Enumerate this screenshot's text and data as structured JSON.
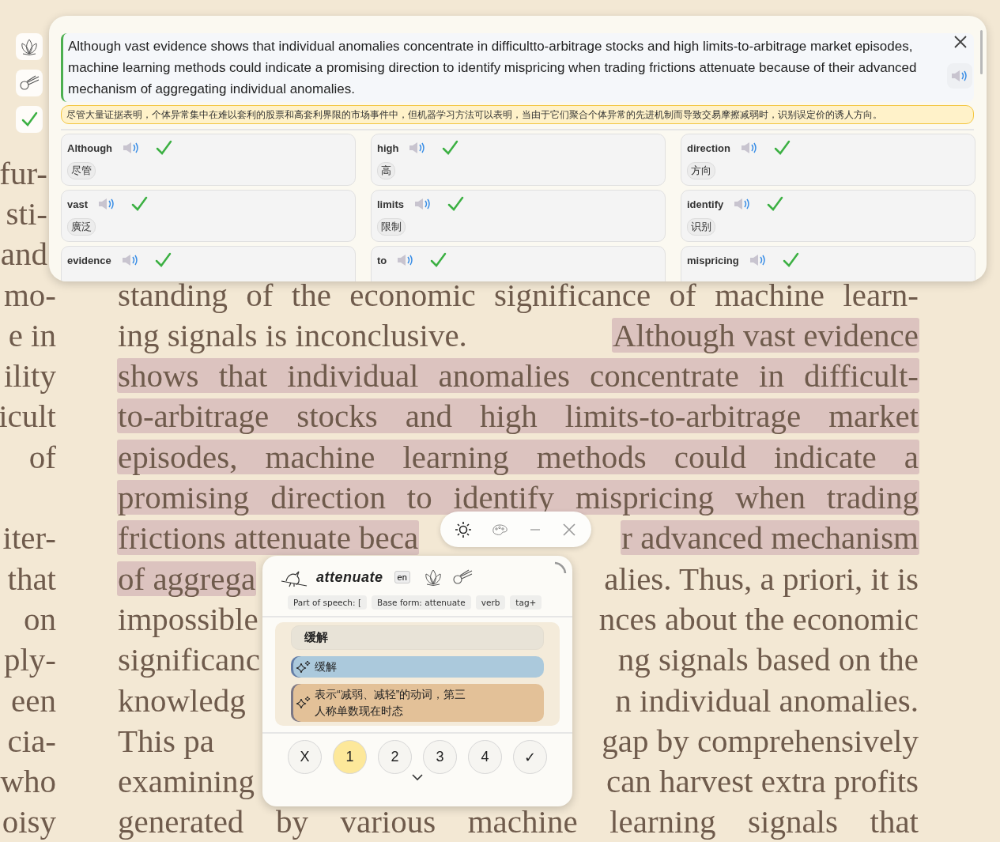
{
  "document": {
    "rows": [
      {
        "left": "fur-"
      },
      {
        "left": "sti-"
      },
      {
        "left": "and"
      },
      {
        "left": "mo-",
        "right": [
          {
            "text": "standing of the economic significance of machine learn-",
            "in_sentence": false
          }
        ]
      },
      {
        "left": "e in",
        "right": [
          {
            "text": "ing signals is inconclusive.",
            "in_sentence": false
          },
          {
            "text": "Although vast evidence",
            "in_sentence": true
          }
        ]
      },
      {
        "left": "ility",
        "right": [
          {
            "text": "shows that individual anomalies concentrate in difficult-",
            "in_sentence": true
          }
        ]
      },
      {
        "left": "icult",
        "right": [
          {
            "text": "to-arbitrage stocks and high limits-to-arbitrage market",
            "in_sentence": true
          }
        ]
      },
      {
        "left": "of",
        "right": [
          {
            "text": "episodes, machine learning methods could indicate a",
            "in_sentence": true
          }
        ]
      },
      {
        "right": [
          {
            "text": "promising direction to identify mispricing when trading",
            "in_sentence": true
          }
        ]
      },
      {
        "left": "iter-",
        "right": [
          {
            "text": "frictions attenuate beca",
            "in_sentence": true
          },
          {
            "text": "r advanced mechanism",
            "in_sentence": true
          }
        ]
      },
      {
        "left": "that",
        "right": [
          {
            "text": "of aggrega",
            "in_sentence": true
          },
          {
            "text": "alies. Thus, a priori, it is",
            "in_sentence": false
          }
        ]
      },
      {
        "left": "on",
        "right": [
          {
            "text": "impossible",
            "in_sentence": false
          },
          {
            "text": "nces about the economic",
            "in_sentence": false
          }
        ]
      },
      {
        "left": "ply-",
        "right": [
          {
            "text": "significanc",
            "in_sentence": false
          },
          {
            "text": "ng signals based on the",
            "in_sentence": false
          }
        ]
      },
      {
        "left": "een",
        "right": [
          {
            "text": "knowledg",
            "in_sentence": false
          },
          {
            "text": "n individual anomalies.",
            "in_sentence": false
          }
        ]
      },
      {
        "left": "cia-",
        "right": [
          {
            "text": "This pa",
            "in_sentence": false
          },
          {
            "text": "gap by comprehensively",
            "in_sentence": false
          }
        ]
      },
      {
        "left": "who",
        "right": [
          {
            "text": "examining",
            "in_sentence": false
          },
          {
            "text": "can harvest extra profits",
            "in_sentence": false
          }
        ]
      },
      {
        "left": "oisy",
        "right": [
          {
            "text": "generated by various machine learning signals that",
            "in_sentence": false
          }
        ]
      }
    ]
  },
  "side_buttons": [
    {
      "kind": "lotus"
    },
    {
      "kind": "comet"
    },
    {
      "kind": "check"
    }
  ],
  "sentence_panel": {
    "sentence": "Although vast evidence shows that individual anomalies concentrate in difficultto-arbitrage stocks and high limits-to-arbitrage market episodes, machine learning methods could indicate a promising direction to identify mispricing when trading frictions attenuate because of their advanced mechanism of aggregating individual anomalies.",
    "translation": "尽管大量证据表明，个体异常集中在难以套利的股票和高套利界限的市场事件中，但机器学习方法可以表明，当由于它们聚合个体异常的先进机制而导致交易摩擦减弱时，识别误定价的诱人方向。",
    "words": [
      {
        "word": "Although",
        "meaning": "尽管",
        "checked": true
      },
      {
        "word": "high",
        "meaning": "高",
        "checked": true
      },
      {
        "word": "direction",
        "meaning": "方向",
        "checked": true
      },
      {
        "word": "vast",
        "meaning": "廣泛",
        "checked": true
      },
      {
        "word": "limits",
        "meaning": "限制",
        "checked": true
      },
      {
        "word": "identify",
        "meaning": "识别",
        "checked": true
      },
      {
        "word": "evidence",
        "checked": true
      },
      {
        "word": "to",
        "checked": true
      },
      {
        "word": "mispricing",
        "checked": true
      }
    ]
  },
  "toolbar": [
    {
      "kind": "sun"
    },
    {
      "kind": "palette"
    },
    {
      "kind": "minimize"
    },
    {
      "kind": "close"
    }
  ],
  "word_popup": {
    "word": "attenuate",
    "language": "en",
    "tags": [
      "Part of speech: [",
      "Base form: attenuate",
      "verb",
      "tag+"
    ],
    "heading": "缓解",
    "meanings": [
      {
        "text": "缓解",
        "color": "#abc9dc"
      },
      {
        "text": "表示“减弱、减轻”的动词，第三人称单数现在时态",
        "color": "#e3c198"
      }
    ],
    "ratings": [
      {
        "label": "X",
        "selected": false
      },
      {
        "label": "1",
        "selected": true
      },
      {
        "label": "2",
        "selected": false
      },
      {
        "label": "3",
        "selected": false
      },
      {
        "label": "4",
        "selected": false
      },
      {
        "label": "✓",
        "selected": false
      }
    ]
  }
}
